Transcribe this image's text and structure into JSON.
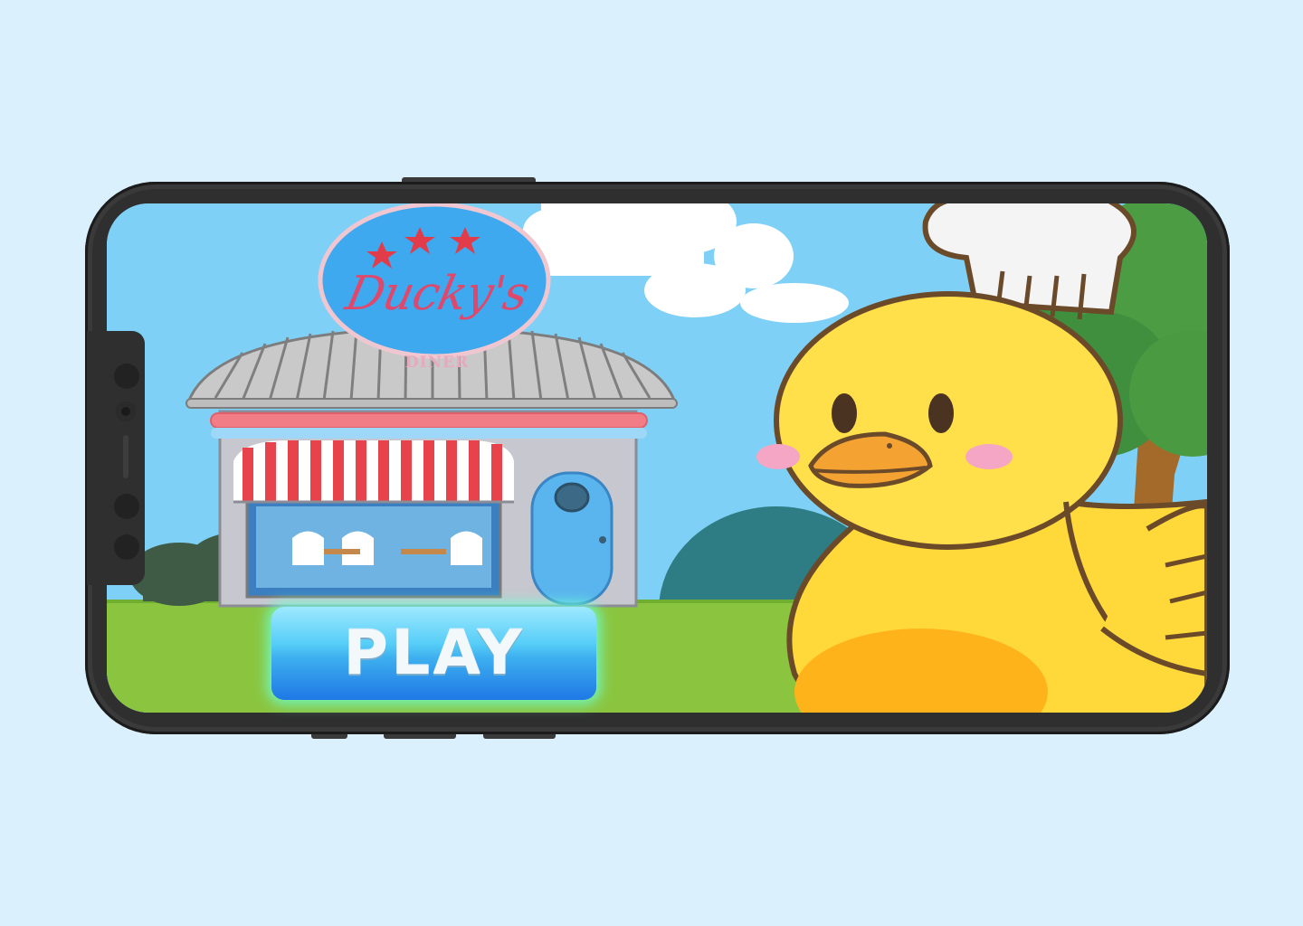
{
  "game": {
    "logo": {
      "script_text": "Ducky's",
      "subtitle": "DINER"
    },
    "play_button": {
      "label": "PLAY"
    }
  },
  "colors": {
    "background": "#daf1fd",
    "phone_frame": "#2f2f2f",
    "sky": "#7ecff6",
    "grass": "#8bc53f",
    "duck_yellow": "#ffd93a",
    "beak_orange": "#f4a232",
    "logo_badge": "#3ea9ee",
    "logo_text": "#e0486b",
    "awning_red": "#e8434a",
    "play_button": "#3dafef",
    "play_glow": "#6effd2"
  },
  "icons": [
    "phone-frame",
    "diner-building",
    "duck-chef-character",
    "star-icon",
    "tree",
    "bush",
    "cloud"
  ]
}
